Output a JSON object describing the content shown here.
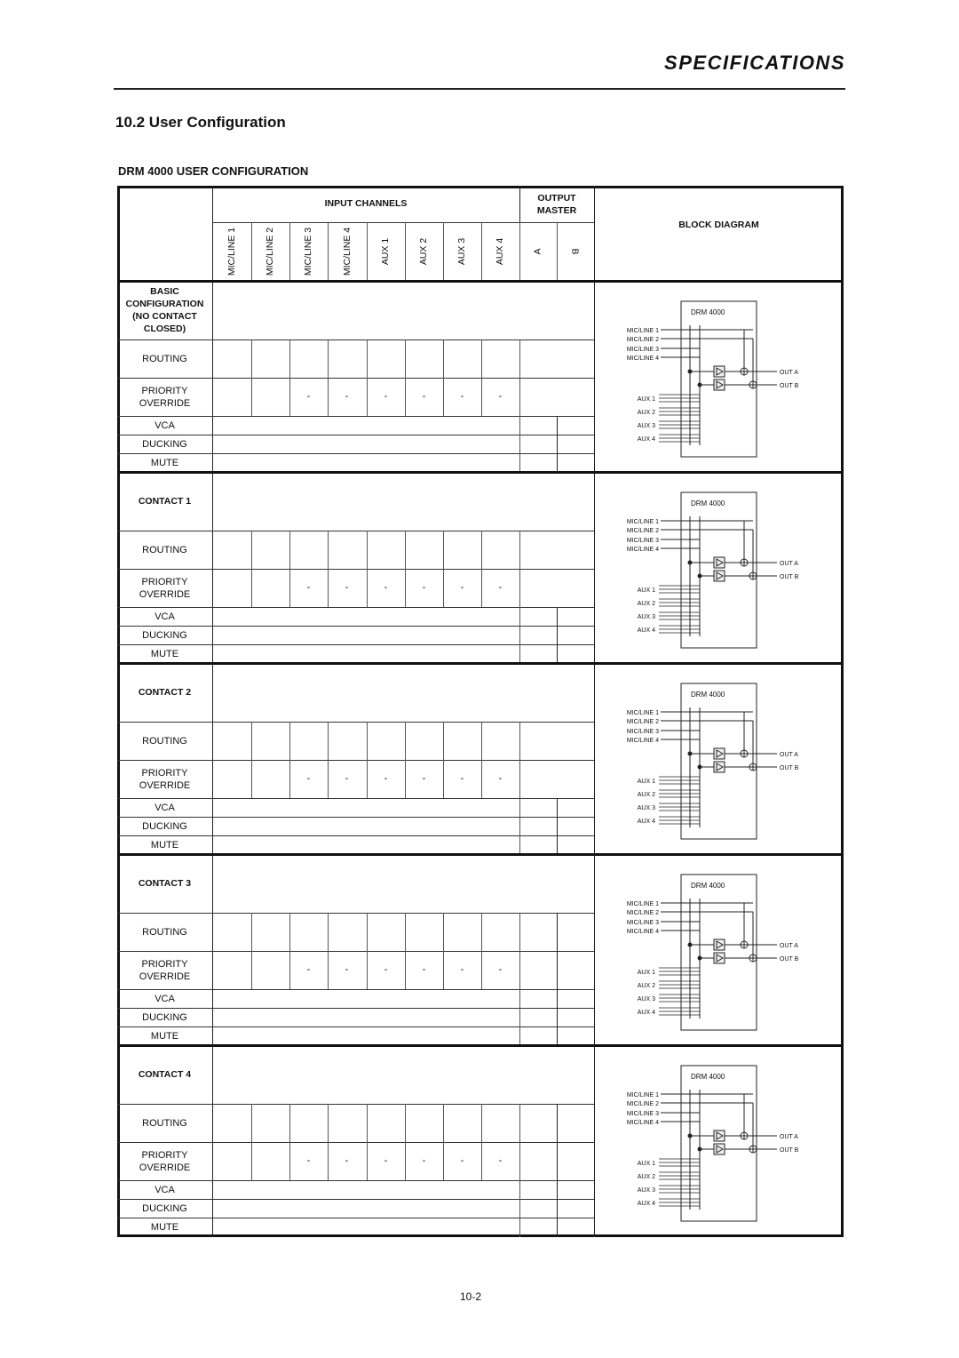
{
  "header": {
    "running_title": "SPECIFICATIONS",
    "section_title": "10.2  User Configuration",
    "table_title": "DRM 4000 USER CONFIGURATION"
  },
  "table": {
    "group_headers": {
      "input_channels": "INPUT CHANNELS",
      "output_master": "OUTPUT MASTER",
      "block_diagram": "BLOCK DIAGRAM"
    },
    "input_columns": [
      "MIC/LINE 1",
      "MIC/LINE 2",
      "MIC/LINE 3",
      "MIC/LINE 4",
      "AUX 1",
      "AUX 2",
      "AUX 3",
      "AUX 4"
    ],
    "output_columns": [
      "A",
      "B"
    ],
    "row_labels": {
      "routing": "ROUTING",
      "priority": "PRIORITY OVERRIDE",
      "vca": "VCA",
      "ducking": "DUCKING",
      "mute": "MUTE"
    },
    "priority_cells": [
      "",
      "",
      "-",
      "-",
      "-",
      "-",
      "-",
      "-"
    ],
    "sections": [
      {
        "title": "BASIC CONFIGURATION (NO CONTACT CLOSED)",
        "split_outputs_in_routing": false
      },
      {
        "title": "CONTACT 1",
        "split_outputs_in_routing": false
      },
      {
        "title": "CONTACT 2",
        "split_outputs_in_routing": false
      },
      {
        "title": "CONTACT 3",
        "split_outputs_in_routing": true
      },
      {
        "title": "CONTACT 4",
        "split_outputs_in_routing": true
      }
    ]
  },
  "block_diagram": {
    "device_label": "DRM 4000",
    "inputs": [
      "MIC/LINE 1",
      "MIC/LINE 2",
      "MIC/LINE 3",
      "MIC/LINE 4"
    ],
    "aux_inputs": [
      "AUX 1",
      "AUX 2",
      "AUX 3",
      "AUX 4"
    ],
    "outputs": [
      "OUT A",
      "OUT B"
    ]
  },
  "footer": {
    "page_number": "10-2"
  }
}
